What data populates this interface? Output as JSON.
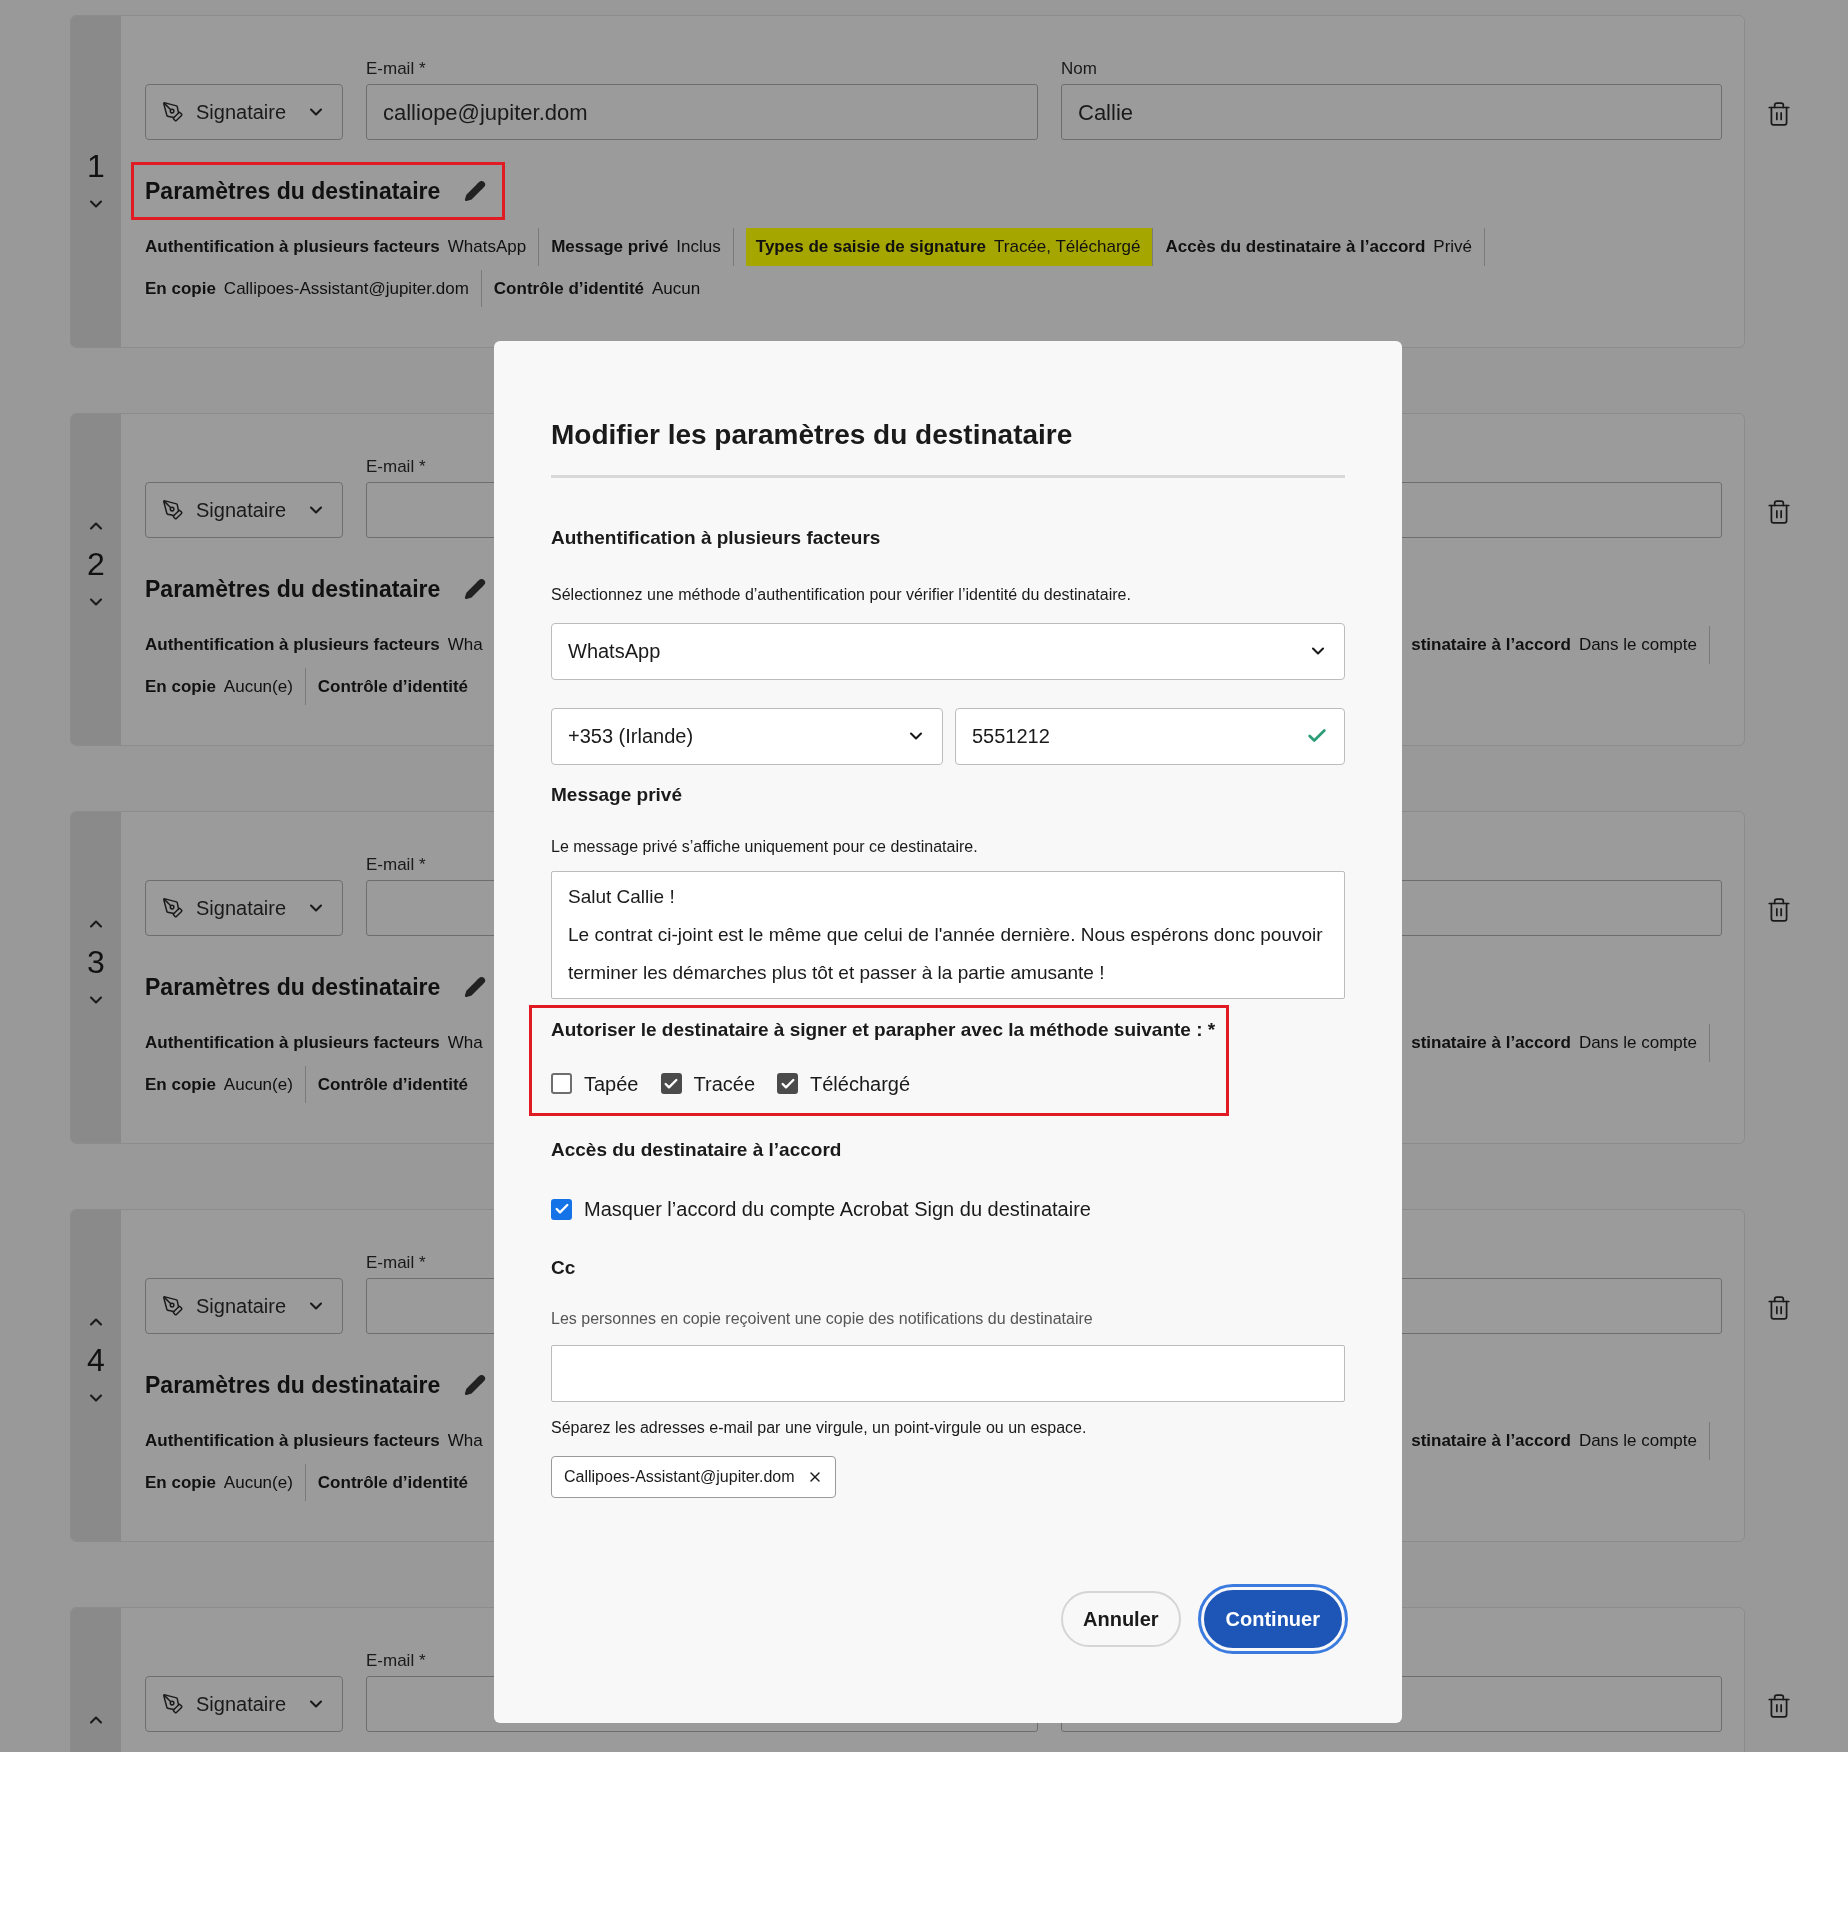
{
  "recipients": [
    {
      "number": "1",
      "role": "Signataire",
      "email_label": "E-mail *",
      "email_value": "calliope@jupiter.dom",
      "name_label": "Nom",
      "name_value": "Callie",
      "can_move_up": false,
      "can_move_down": true,
      "settings_title": "Paramètres du destinataire",
      "outlined": true,
      "lines": [
        {
          "left": [
            {
              "label": "Authentification à plusieurs facteurs",
              "value": "WhatsApp",
              "divider": true,
              "highlighted": false
            },
            {
              "label": "Message privé",
              "value": "Inclus",
              "divider": true,
              "highlighted": false
            },
            {
              "label": "Types de saisie de signature",
              "value": "Tracée, Téléchargé",
              "divider": true,
              "highlighted": true
            },
            {
              "label": "Accès du destinataire à l’accord",
              "value": "Privé",
              "divider": true,
              "highlighted": false
            }
          ]
        },
        {
          "left": [
            {
              "label": "En copie",
              "value": "Callipoes-Assistant@jupiter.dom",
              "divider": true,
              "highlighted": false
            },
            {
              "label": "Contrôle d’identité",
              "value": "Aucun",
              "divider": false,
              "highlighted": false
            }
          ]
        }
      ]
    },
    {
      "number": "2",
      "role": "Signataire",
      "email_label": "E-mail *",
      "can_move_up": true,
      "can_move_down": true,
      "settings_title": "Paramètres du destinataire",
      "outlined": false,
      "lines": [
        {
          "left": [
            {
              "label": "Authentification à plusieurs facteurs",
              "value": "Wha",
              "divider": false,
              "highlighted": false
            }
          ],
          "right": [
            {
              "label": "stinataire à l’accord",
              "value": "Dans le compte",
              "divider": true,
              "highlighted": false
            }
          ]
        },
        {
          "left": [
            {
              "label": "En copie",
              "value": "Aucun(e)",
              "divider": true,
              "highlighted": false
            },
            {
              "label": "Contrôle d’identité",
              "divider": false,
              "highlighted": false
            }
          ]
        }
      ]
    },
    {
      "number": "3",
      "role": "Signataire",
      "email_label": "E-mail *",
      "can_move_up": true,
      "can_move_down": true,
      "settings_title": "Paramètres du destinataire",
      "outlined": false,
      "lines": [
        {
          "left": [
            {
              "label": "Authentification à plusieurs facteurs",
              "value": "Wha",
              "divider": false,
              "highlighted": false
            }
          ],
          "right": [
            {
              "label": "stinataire à l’accord",
              "value": "Dans le compte",
              "divider": true,
              "highlighted": false
            }
          ]
        },
        {
          "left": [
            {
              "label": "En copie",
              "value": "Aucun(e)",
              "divider": true,
              "highlighted": false
            },
            {
              "label": "Contrôle d’identité",
              "divider": false,
              "highlighted": false
            }
          ]
        }
      ]
    },
    {
      "number": "4",
      "role": "Signataire",
      "email_label": "E-mail *",
      "can_move_up": true,
      "can_move_down": true,
      "settings_title": "Paramètres du destinataire",
      "outlined": false,
      "lines": [
        {
          "left": [
            {
              "label": "Authentification à plusieurs facteurs",
              "value": "Wha",
              "divider": false,
              "highlighted": false
            }
          ],
          "right": [
            {
              "label": "stinataire à l’accord",
              "value": "Dans le compte",
              "divider": true,
              "highlighted": false
            }
          ]
        },
        {
          "left": [
            {
              "label": "En copie",
              "value": "Aucun(e)",
              "divider": true,
              "highlighted": false
            },
            {
              "label": "Contrôle d’identité",
              "divider": false,
              "highlighted": false
            }
          ]
        }
      ]
    },
    {
      "role": "Signataire",
      "email_label": "E-mail *",
      "can_move_up": true,
      "can_move_down": false
    }
  ],
  "dialog": {
    "title": "Modifier les paramètres du destinataire",
    "mfa": {
      "heading": "Authentification à plusieurs facteurs",
      "description": "Sélectionnez une méthode d’authentification pour vérifier l’identité du destinataire.",
      "method": "WhatsApp",
      "country": "+353 (Irlande)",
      "phone": "5551212",
      "phone_valid": true
    },
    "private_message": {
      "heading": "Message privé",
      "description": "Le message privé s’affiche uniquement pour ce destinataire.",
      "value": "Salut Callie !\nLe contrat ci-joint est le même que celui de l'année dernière. Nous espérons donc pouvoir terminer les démarches plus tôt et passer à la partie amusante !"
    },
    "signature_methods": {
      "heading": "Autoriser le destinataire à signer et parapher avec la méthode suivante : *",
      "outlined": true,
      "options": [
        {
          "label": "Tapée",
          "checked": false
        },
        {
          "label": "Tracée",
          "checked": true
        },
        {
          "label": "Téléchargé",
          "checked": true
        }
      ]
    },
    "access": {
      "heading": "Accès du destinataire à l’accord",
      "options": [
        {
          "label": "Masquer l’accord du compte Acrobat Sign du destinataire",
          "checked": true
        }
      ]
    },
    "cc": {
      "heading": "Cc",
      "description": "Les personnes en copie reçoivent une copie des notifications du destinataire",
      "hint": "Séparez les adresses e-mail par une virgule, un point-virgule ou un espace.",
      "tags": [
        "Callipoes-Assistant@jupiter.dom"
      ]
    },
    "buttons": [
      {
        "label": "Annuler",
        "kind": "secondary"
      },
      {
        "label": "Continuer",
        "kind": "primary"
      }
    ]
  }
}
